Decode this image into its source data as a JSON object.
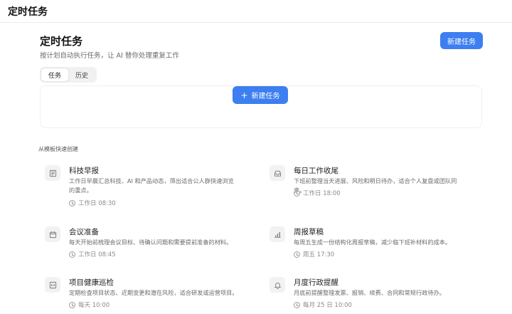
{
  "app": {
    "title": "定时任务"
  },
  "page": {
    "title": "定时任务",
    "subtitle": "按计划自动执行任务，让 AI 替你处理重复工作",
    "new_task_label": "新建任务"
  },
  "tabs": [
    {
      "label": "任务",
      "active": true
    },
    {
      "label": "历史",
      "active": false
    }
  ],
  "empty_state": {
    "new_task_label": "新建任务",
    "plus_icon": "+"
  },
  "templates": {
    "section_label": "从模板快速创建",
    "items": [
      {
        "title": "科技早报",
        "description": "工作日早晨汇总科技、AI 和产品动态，筛出适合公人群快速浏览的重点。",
        "schedule": "工作日 08:30",
        "icon": "newspaper-icon"
      },
      {
        "title": "每日工作收尾",
        "description": "下班前整理当天进展、风险和明日待办，适合个人复盘或团队同步。",
        "schedule": "工作日 18:00",
        "icon": "inbox-icon"
      },
      {
        "title": "会议准备",
        "description": "每天开始前梳理会议目标、待确认问题和需要提前准备的材料。",
        "schedule": "工作日 08:45",
        "icon": "calendar-icon"
      },
      {
        "title": "周报草稿",
        "description": "每周五生成一份结构化周报草稿，减少临下班补材料的成本。",
        "schedule": "周五 17:30",
        "icon": "bar-chart-icon"
      },
      {
        "title": "项目健康巡检",
        "description": "定期检查项目状态、近期变更和潜在风险，适合研发或运营项目。",
        "schedule": "每天 10:00",
        "icon": "code-icon"
      },
      {
        "title": "月度行政提醒",
        "description": "月底前提醒整理发票、报销、续费、合同和常规行政待办。",
        "schedule": "每月 25 日 10:00",
        "icon": "bell-icon"
      }
    ]
  },
  "colors": {
    "accent": "#3d7ff0",
    "icon_bg": "#f2f2f2"
  }
}
